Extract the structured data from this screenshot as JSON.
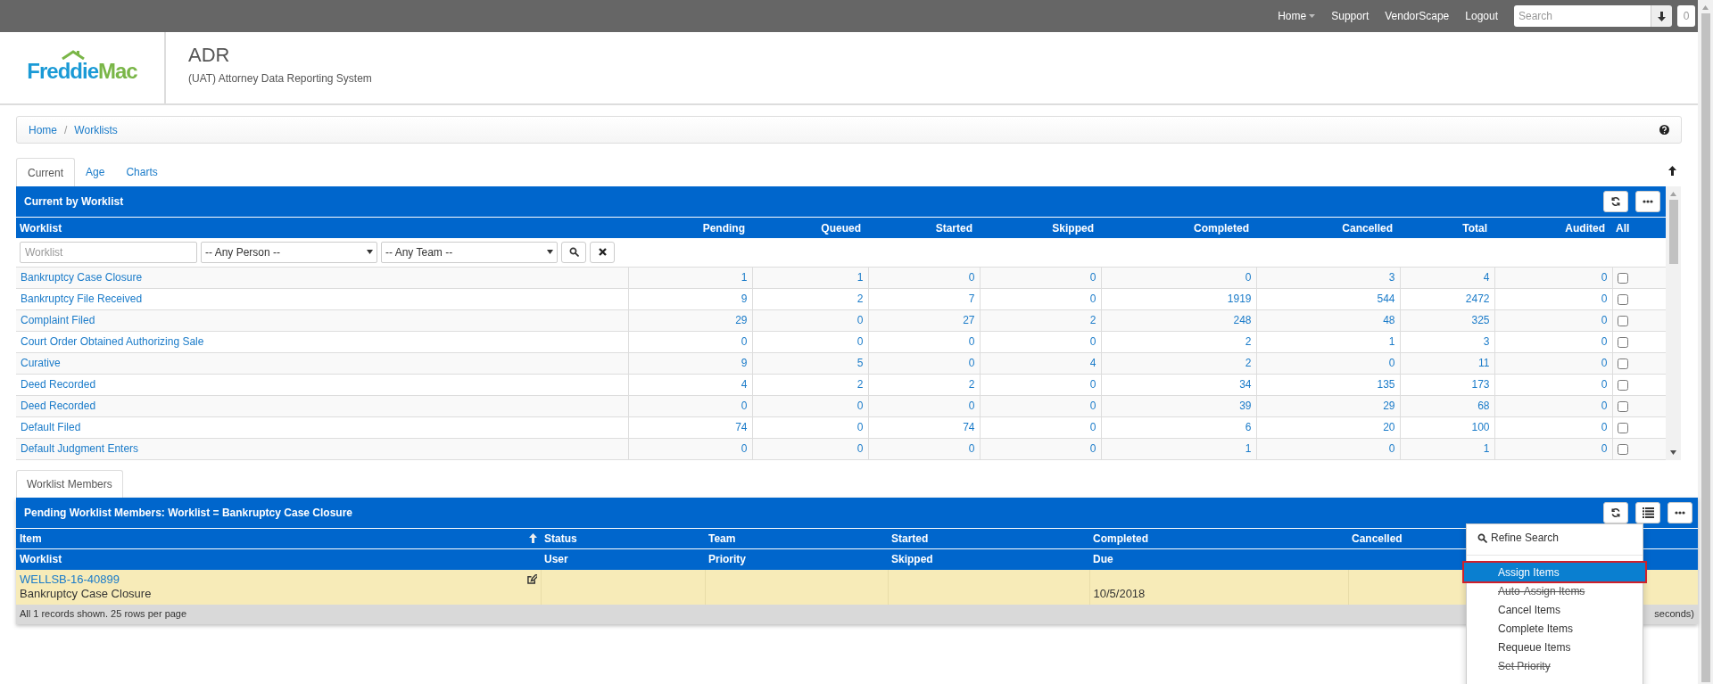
{
  "top_nav": {
    "items": [
      {
        "label": "Home",
        "kind": "menu"
      },
      {
        "label": "Support",
        "kind": "link"
      },
      {
        "label": "VendorScape",
        "kind": "link"
      },
      {
        "label": "Logout",
        "kind": "link"
      }
    ],
    "search": {
      "placeholder": "Search"
    },
    "badge": "0"
  },
  "header": {
    "logo_part1": "Freddie",
    "logo_part2": "Mac",
    "title": "ADR",
    "subtitle": "(UAT) Attorney Data Reporting System"
  },
  "breadcrumb": {
    "items": [
      "Home",
      "Worklists"
    ],
    "separator": "/"
  },
  "tabs": [
    {
      "label": "Current",
      "selected": true
    },
    {
      "label": "Age",
      "selected": false
    },
    {
      "label": "Charts",
      "selected": false
    }
  ],
  "current_panel": {
    "title": "Current by Worklist",
    "columns": [
      "Worklist",
      "Pending",
      "Queued",
      "Started",
      "Skipped",
      "Completed",
      "Cancelled",
      "Total",
      "Audited",
      "All"
    ],
    "filters": {
      "worklist_placeholder": "Worklist",
      "person": "-- Any Person --",
      "team": "-- Any Team --"
    },
    "rows": [
      {
        "cells": [
          "Bankruptcy Case Closure",
          "1",
          "1",
          "0",
          "0",
          "0",
          "3",
          "4",
          "0"
        ],
        "checked": false
      },
      {
        "cells": [
          "Bankruptcy File Received",
          "9",
          "2",
          "7",
          "0",
          "1919",
          "544",
          "2472",
          "0"
        ],
        "checked": false
      },
      {
        "cells": [
          "Complaint Filed",
          "29",
          "0",
          "27",
          "2",
          "248",
          "48",
          "325",
          "0"
        ],
        "checked": false
      },
      {
        "cells": [
          "Court Order Obtained Authorizing Sale",
          "0",
          "0",
          "0",
          "0",
          "2",
          "1",
          "3",
          "0"
        ],
        "checked": false
      },
      {
        "cells": [
          "Curative",
          "9",
          "5",
          "0",
          "4",
          "2",
          "0",
          "11",
          "0"
        ],
        "checked": false
      },
      {
        "cells": [
          "Deed Recorded",
          "4",
          "2",
          "2",
          "0",
          "34",
          "135",
          "173",
          "0"
        ],
        "checked": false
      },
      {
        "cells": [
          "Deed Recorded",
          "0",
          "0",
          "0",
          "0",
          "39",
          "29",
          "68",
          "0"
        ],
        "checked": false
      },
      {
        "cells": [
          "Default Filed",
          "74",
          "0",
          "74",
          "0",
          "6",
          "20",
          "100",
          "0"
        ],
        "checked": false
      },
      {
        "cells": [
          "Default Judgment Enters",
          "0",
          "0",
          "0",
          "0",
          "1",
          "0",
          "1",
          "0"
        ],
        "checked": false
      }
    ]
  },
  "members_tabs": [
    {
      "label": "Worklist Members",
      "selected": true
    }
  ],
  "members_panel": {
    "title": "Pending Worklist Members: Worklist = Bankruptcy Case Closure",
    "header_row_1": [
      "Item",
      "Status",
      "Team",
      "Started",
      "Completed",
      "Cancelled"
    ],
    "header_row_2": [
      "Worklist",
      "User",
      "Priority",
      "Skipped",
      "Due"
    ],
    "rows": [
      {
        "item": "WELLSB-16-40899",
        "worklist": "Bankruptcy Case Closure",
        "due": "10/5/2018"
      }
    ],
    "footer": "All 1 records shown. 25 rows per page",
    "footer_right": "seconds)"
  },
  "menu": {
    "items": [
      {
        "kind": "search",
        "label": "Refine Search"
      },
      {
        "kind": "divider"
      },
      {
        "kind": "action",
        "label": "Assign Items",
        "selected": true,
        "disabled": false
      },
      {
        "kind": "action",
        "label": "Auto-Assign Items",
        "selected": false,
        "disabled": true
      },
      {
        "kind": "action",
        "label": "Cancel Items",
        "selected": false,
        "disabled": false
      },
      {
        "kind": "action",
        "label": "Complete Items",
        "selected": false,
        "disabled": false
      },
      {
        "kind": "action",
        "label": "Requeue Items",
        "selected": false,
        "disabled": false
      },
      {
        "kind": "action",
        "label": "Set Priority",
        "selected": false,
        "disabled": true
      }
    ]
  }
}
